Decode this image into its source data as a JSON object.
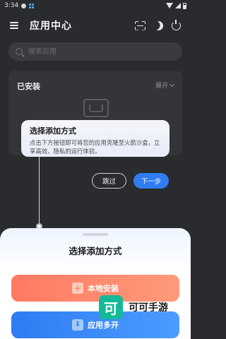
{
  "status_bar": {
    "time": "3:34"
  },
  "header": {
    "title": "应用中心"
  },
  "search": {
    "placeholder": "搜索应用"
  },
  "installed": {
    "title": "已安装",
    "expand_label": "展开"
  },
  "tooltip": {
    "title": "选择添加方式",
    "description": "点击下方按钮即可将您的应用克隆至火箭沙盒，立享高效、隐私的运行体验。",
    "skip_label": "跳过",
    "next_label": "下一步"
  },
  "sheet": {
    "title": "选择添加方式",
    "local_install_label": "本地安装",
    "multi_open_label": "应用多开"
  },
  "watermark": {
    "logo_text": "可",
    "text": "可可手游"
  },
  "colors": {
    "accent_blue": "#2f7cf3",
    "accent_orange": "#ff7a62",
    "watermark_green": "#14b998"
  }
}
